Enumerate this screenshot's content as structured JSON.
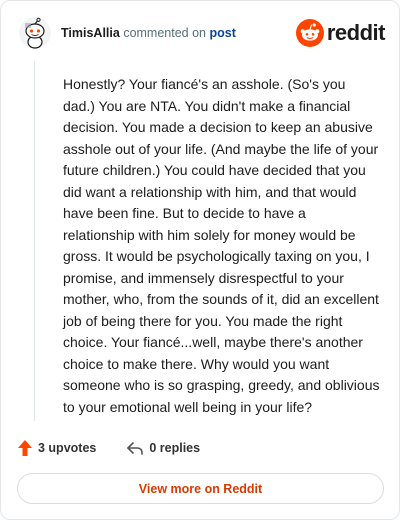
{
  "comment": {
    "author": "TimisAllia",
    "action_text": "commented on",
    "post_link": "post",
    "body": "Honestly? Your fiancé's an asshole. (So's you dad.) You are NTA. You didn't make a financial decision. You made a decision to keep an abusive asshole out of your life. (And maybe the life of your future children.) You could have decided that you did want a relationship with him, and that would have been fine. But to decide to have a relationship with him solely for money would be gross. It would be psychologically taxing on you, I promise, and immensely disrespectful to your mother, who, from the sounds of it, did an excellent job of being there for you. You made the right choice. Your fiancé...well, maybe there's another choice to make there. Why would you want someone who is so grasping, greedy, and oblivious to your emotional well being in your life?",
    "upvotes_label": "3 upvotes",
    "replies_label": "0 replies"
  },
  "brand": {
    "wordmark": "reddit",
    "logo_icon": "reddit-snoo-icon",
    "accent": "#ff4500"
  },
  "icons": {
    "upvote": "upvote-arrow-icon",
    "reply": "reply-arrow-icon",
    "avatar": "snoo-avatar-icon"
  },
  "cta": {
    "label": "View more on Reddit",
    "color": "#d93a00"
  }
}
